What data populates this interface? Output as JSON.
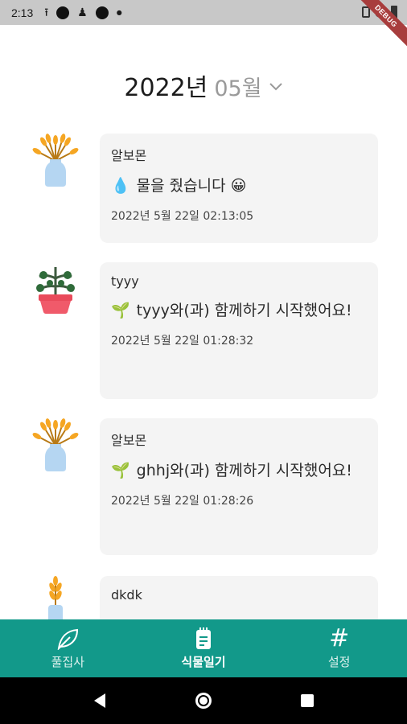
{
  "status_bar": {
    "time": "2:13",
    "debug_label": "DEBUG"
  },
  "header": {
    "year": "2022년",
    "month": "05월"
  },
  "feed": [
    {
      "name": "알보몬",
      "emoji": "💧",
      "message": "물을 줬습니다 😀",
      "timestamp": "2022년 5월 22일 02:13:05",
      "avatar": "wheat-vase-icon"
    },
    {
      "name": "tyyy",
      "emoji": "🌱",
      "message": "tyyy와(과) 함께하기 시작했어요!",
      "timestamp": "2022년 5월 22일 01:28:32",
      "avatar": "potted-plant-icon"
    },
    {
      "name": "알보몬",
      "emoji": "🌱",
      "message": "ghhj와(과) 함께하기 시작했어요!",
      "timestamp": "2022년 5월 22일 01:28:26",
      "avatar": "wheat-vase-icon"
    },
    {
      "name": "dkdk",
      "avatar": "wheat-bottle-icon"
    }
  ],
  "bottom_nav": [
    {
      "label": "풀집사",
      "icon": "leaf-icon",
      "active": false
    },
    {
      "label": "식물일기",
      "icon": "notepad-icon",
      "active": true
    },
    {
      "label": "설정",
      "icon": "hash-icon",
      "active": false
    }
  ],
  "colors": {
    "accent": "#12998a",
    "card": "#f4f4f4",
    "month": "#9a9a9a"
  }
}
